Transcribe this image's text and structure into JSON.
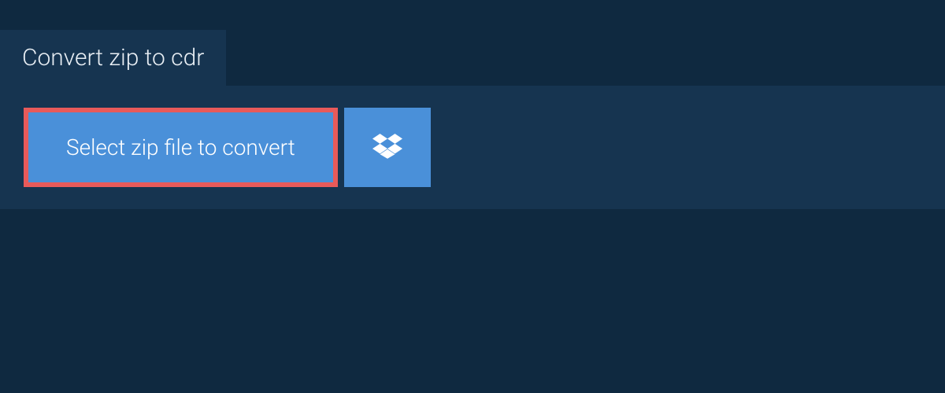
{
  "header": {
    "title": "Convert zip to cdr"
  },
  "actions": {
    "select_file_label": "Select zip file to convert",
    "dropbox_icon": "dropbox-icon"
  },
  "colors": {
    "background": "#0f2940",
    "panel": "#163450",
    "button": "#4a90d9",
    "highlight_border": "#e85a5a",
    "text": "#ffffff"
  }
}
